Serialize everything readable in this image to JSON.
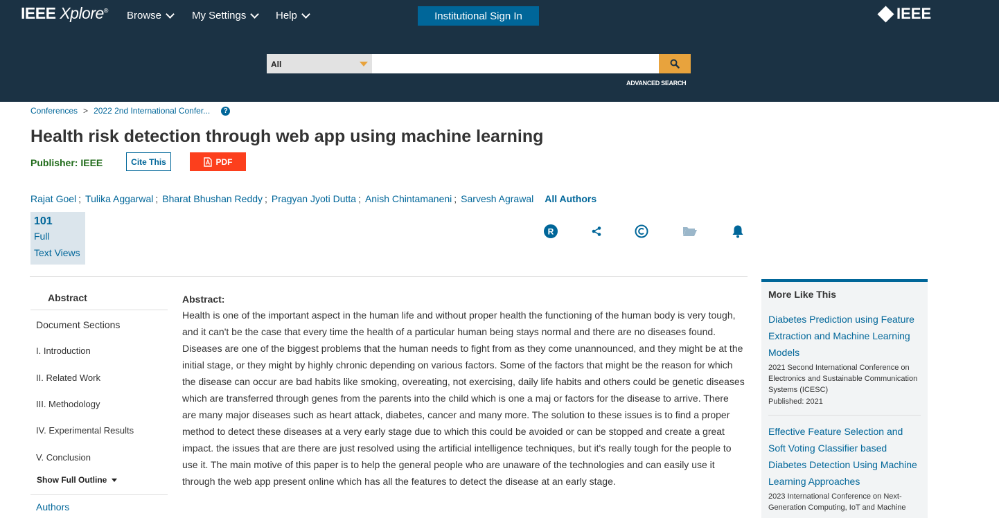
{
  "header": {
    "logo_main": "IEEE",
    "logo_sub": "Xplore",
    "logo_reg": "®",
    "nav": [
      "Browse",
      "My Settings",
      "Help"
    ],
    "inst_sign_in": "Institutional Sign In",
    "ieee_brand": "IEEE"
  },
  "search": {
    "scope": "All",
    "query": "",
    "advanced": "ADVANCED SEARCH"
  },
  "breadcrumb": {
    "item1": "Conferences",
    "sep": ">",
    "item2": "2022 2nd International Confer...",
    "help": "?"
  },
  "article": {
    "title": "Health risk detection through web app using machine learning",
    "publisher": "Publisher:  IEEE",
    "cite": "Cite This",
    "pdf": "PDF",
    "authors": [
      "Rajat Goel",
      "Tulika Aggarwal",
      "Bharat Bhushan Reddy",
      "Pragyan Jyoti Dutta",
      "Anish Chintamaneni",
      "Sarvesh Agrawal"
    ],
    "all_authors": "All Authors",
    "metric_num": "101",
    "metric_l1": "Full",
    "metric_l2": "Text Views"
  },
  "icons": {
    "rights": "registered-icon",
    "share": "share-icon",
    "copyright": "copyright-icon",
    "folder": "folder-icon",
    "alert": "bell-icon"
  },
  "sidebar": {
    "abstract_tab": "Abstract",
    "document_sections": "Document Sections",
    "sections": [
      "I.  Introduction",
      "II.  Related Work",
      "III.  Methodology",
      "IV.  Experimental Results",
      "V.  Conclusion"
    ],
    "show_outline": "Show Full Outline",
    "authors": "Authors"
  },
  "abstract": {
    "label": "Abstract:",
    "text": "Health is one of the important aspect in the human life and without proper health the functioning of the human body is very tough, and it can't be the case that every time the health of a particular human being stays normal and there are no diseases found. Diseases are one of the biggest problems that the human needs to fight from as they come unannounced, and they might be at the initial stage, or they might by highly chronic depending on various factors. Some of the factors that might be the reason for which the disease can occur are bad habits like smoking, overeating, not exercising, daily life habits and others could be genetic diseases which are transferred through genes from the parents into the child which is one a maj or factors for the disease to arrive. There are many major diseases such as heart attack, diabetes, cancer and many more. The solution to these issues is to find a proper method to detect these diseases at a very early stage due to which this could be avoided or can be stopped and create a great impact. the issues that are there are just resolved using the artificial intelligence techniques, but it's really tough for the people to use it. The main motive of this paper is to help the general people who are unaware of the technologies and can easily use it through the web app present online which has all the features to detect the disease at an early stage."
  },
  "more_like_this": {
    "heading": "More Like This",
    "items": [
      {
        "title": "Diabetes Prediction using Feature Extraction and Machine Learning Models",
        "venue": "2021 Second International Conference on Electronics and Sustainable Communication Systems (ICESC)",
        "published": "Published: 2021"
      },
      {
        "title": "Effective Feature Selection and Soft Voting Classifier based Diabetes Detection Using Machine Learning Approaches",
        "venue": "2023 International Conference on Next-Generation Computing, IoT and Machine",
        "published": ""
      }
    ]
  },
  "colors": {
    "header_bg": "#1b3244",
    "link": "#006699",
    "pdf": "#fc3f1d",
    "search_btn": "#e8a33d",
    "publisher": "#206b1a"
  }
}
